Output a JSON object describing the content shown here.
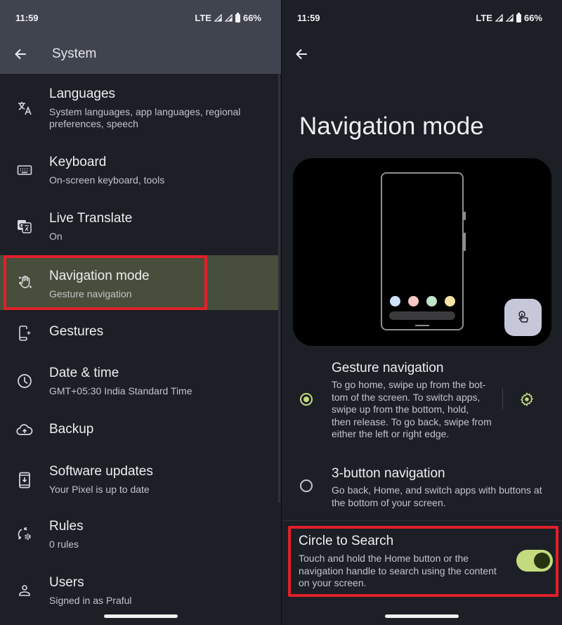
{
  "status_bar": {
    "time": "11:59",
    "network": "LTE",
    "battery": "66%"
  },
  "left_screen": {
    "title": "System",
    "items": [
      {
        "icon": "translate-icon",
        "title": "Languages",
        "subtitle_lines": [
          "System languages, app languages, regional",
          "preferences, speech"
        ]
      },
      {
        "icon": "keyboard-icon",
        "title": "Keyboard",
        "subtitle_lines": [
          "On-screen keyboard, tools"
        ]
      },
      {
        "icon": "live-translate-icon",
        "title": "Live Translate",
        "subtitle_lines": [
          "On"
        ]
      },
      {
        "icon": "gesture-hand-icon",
        "title": "Navigation mode",
        "subtitle_lines": [
          "Gesture navigation"
        ],
        "selected": true,
        "highlighted": true
      },
      {
        "icon": "gestures-phone-icon",
        "title": "Gestures",
        "subtitle_lines": []
      },
      {
        "icon": "clock-icon",
        "title": "Date & time",
        "subtitle_lines": [
          "GMT+05:30 India Standard Time"
        ]
      },
      {
        "icon": "cloud-upload-icon",
        "title": "Backup",
        "subtitle_lines": []
      },
      {
        "icon": "system-update-icon",
        "title": "Software updates",
        "subtitle_lines": [
          "Your Pixel is up to date"
        ]
      },
      {
        "icon": "rules-icon",
        "title": "Rules",
        "subtitle_lines": [
          "0 rules"
        ]
      },
      {
        "icon": "person-icon",
        "title": "Users",
        "subtitle_lines": [
          "Signed in as Praful"
        ]
      }
    ]
  },
  "right_screen": {
    "title": "Navigation mode",
    "preview": {
      "dot_colors": [
        "#cfe0fb",
        "#f5c8c4",
        "#bfe4c8",
        "#f5e3a6"
      ],
      "fab_icon": "touch-hand-icon"
    },
    "options": [
      {
        "title": "Gesture navigation",
        "description": "To go home, swipe up from the bot- tom of the screen. To switch apps, swipe up from the bottom, hold, then release. To go back, swipe from either the left or right edge.",
        "description_lines": [
          "To go home, swipe up from the bot-",
          "tom of the screen. To switch apps,",
          "swipe up from the bottom, hold,",
          "then release. To go back, swipe from",
          "either the left or right edge."
        ],
        "selected": true,
        "settings_icon": "gear-icon"
      },
      {
        "title": "3-button navigation",
        "description_lines": [
          "Go back, Home, and switch apps with buttons at",
          "the bottom of your screen."
        ],
        "selected": false
      }
    ],
    "circle_to_search": {
      "title": "Circle to Search",
      "description_lines": [
        "Touch and hold the Home button or the",
        "navigation handle to search using the content",
        "on your screen."
      ],
      "enabled": true,
      "highlighted": true
    }
  },
  "colors": {
    "accent": "#c4db7d",
    "selected_row": "#474e3b",
    "highlight_border": "#e0202a",
    "app_bar_left": "#40444f",
    "background": "#1c1f26"
  }
}
